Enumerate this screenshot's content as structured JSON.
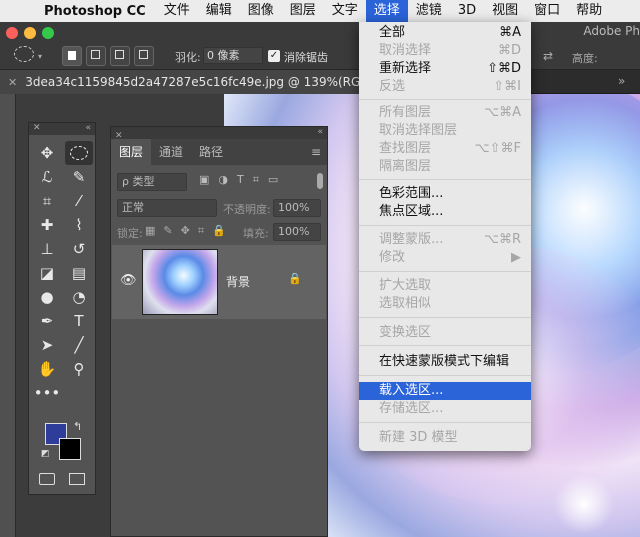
{
  "menubar": {
    "app_name": "Photoshop CC",
    "items": [
      "文件",
      "编辑",
      "图像",
      "图层",
      "文字",
      "选择",
      "滤镜",
      "3D",
      "视图",
      "窗口",
      "帮助"
    ],
    "active_index": 5
  },
  "window": {
    "title_partial": "Adobe Ph"
  },
  "options_bar": {
    "feather_label": "羽化:",
    "feather_value": "0 像素",
    "antialias_label": "消除锯齿",
    "height_label": "高度:"
  },
  "document": {
    "tab_title": "3dea34c1159845d2a47287e5c16fc49e.jpg @ 139%(RGB/8*) *"
  },
  "layers_panel": {
    "tabs": [
      "图层",
      "通道",
      "路径"
    ],
    "filter_placeholder": "ρ 类型",
    "blend_mode": "正常",
    "opacity_label": "不透明度:",
    "opacity_value": "100%",
    "lock_label": "锁定:",
    "fill_label": "填充:",
    "fill_value": "100%",
    "layer_name": "背景"
  },
  "select_menu": {
    "all": {
      "label": "全部",
      "shortcut": "⌘A"
    },
    "deselect": {
      "label": "取消选择",
      "shortcut": "⌘D"
    },
    "reselect": {
      "label": "重新选择",
      "shortcut": "⇧⌘D"
    },
    "inverse": {
      "label": "反选",
      "shortcut": "⇧⌘I"
    },
    "all_layers": {
      "label": "所有图层",
      "shortcut": "⌥⌘A"
    },
    "deselect_layers": {
      "label": "取消选择图层"
    },
    "find_layers": {
      "label": "查找图层",
      "shortcut": "⌥⇧⌘F"
    },
    "isolate_layers": {
      "label": "隔离图层"
    },
    "color_range": {
      "label": "色彩范围..."
    },
    "focus_area": {
      "label": "焦点区域..."
    },
    "refine_mask": {
      "label": "调整蒙版...",
      "shortcut": "⌥⌘R"
    },
    "modify": {
      "label": "修改",
      "shortcut": "▶"
    },
    "grow": {
      "label": "扩大选取"
    },
    "similar": {
      "label": "选取相似"
    },
    "transform_selection": {
      "label": "变换选区"
    },
    "quick_mask": {
      "label": "在快速蒙版模式下编辑"
    },
    "load_selection": {
      "label": "载入选区..."
    },
    "save_selection": {
      "label": "存储选区..."
    },
    "new_3d": {
      "label": "新建 3D 模型"
    }
  },
  "colors": {
    "menu_highlight": "#2b63d9",
    "foreground_color": "#2e3d9a",
    "background_color": "#000000"
  }
}
